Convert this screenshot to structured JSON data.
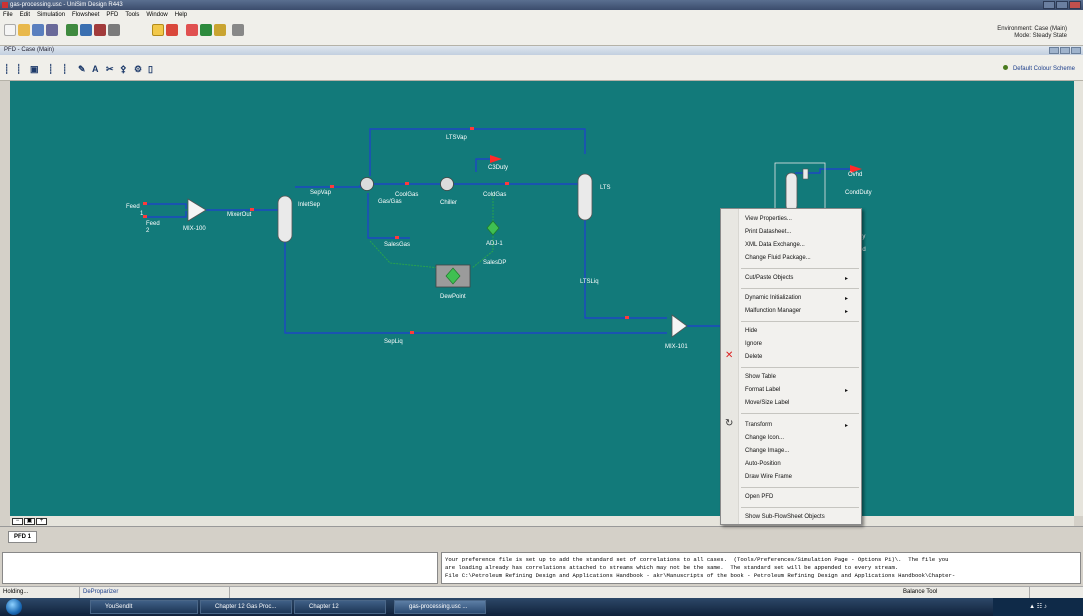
{
  "window": {
    "title": "gas-processing.usc - UniSim Design R443"
  },
  "menubar": {
    "items": [
      "File",
      "Edit",
      "Simulation",
      "Flowsheet",
      "PFD",
      "Tools",
      "Window",
      "Help"
    ]
  },
  "environment": {
    "line1": "Environment: Case (Main)",
    "line2": "Mode: Steady State"
  },
  "pfd": {
    "title": "PFD - Case (Main)",
    "color_scheme": "Default Colour Scheme",
    "tab": "PFD 1",
    "canvas_color": "#127a7a",
    "labels": {
      "feed1": "Feed\n1",
      "feed2": "Feed\n2",
      "mix100": "MIX-100",
      "mixerout": "MixerOut",
      "inletsep": "InletSep",
      "sepvap": "SepVap",
      "gasgas": "Gas/Gas",
      "coolgas": "CoolGas",
      "chiller": "Chiller",
      "coldgas": "ColdGas",
      "c3duty": "C3Duty",
      "lts": "LTS",
      "ltsvap": "LTSVap",
      "salesgas": "SalesGas",
      "adj1": "ADJ-1",
      "salesdp": "SalesDP",
      "dewpoint": "DewPoint",
      "ltsliq": "LTSLiq",
      "sepliq": "SepLiq",
      "mix101": "MIX-101",
      "ovhd": "Ovhd",
      "condduty": "CondDuty",
      "duty": "Duty",
      "prod": "Prod"
    }
  },
  "context_menu": {
    "items": [
      {
        "label": "View Properties...",
        "submenu": false,
        "group": 1
      },
      {
        "label": "Print Datasheet...",
        "submenu": false,
        "group": 1
      },
      {
        "label": "XML Data Exchange...",
        "submenu": false,
        "group": 1
      },
      {
        "label": "Change Fluid Package...",
        "submenu": false,
        "group": 1
      },
      {
        "label": "Cut/Paste Objects",
        "submenu": true,
        "group": 2
      },
      {
        "label": "Dynamic Initialization",
        "submenu": true,
        "group": 3
      },
      {
        "label": "Malfunction Manager",
        "submenu": true,
        "group": 3
      },
      {
        "label": "Hide",
        "submenu": false,
        "group": 4
      },
      {
        "label": "Ignore",
        "submenu": false,
        "group": 4
      },
      {
        "label": "Delete",
        "submenu": false,
        "group": 4,
        "icon": "delete-icon"
      },
      {
        "label": "Show Table",
        "submenu": false,
        "group": 5
      },
      {
        "label": "Format Label",
        "submenu": true,
        "group": 5
      },
      {
        "label": "Move/Size Label",
        "submenu": false,
        "group": 5
      },
      {
        "label": "Transform",
        "submenu": true,
        "group": 6,
        "icon": "transform-icon"
      },
      {
        "label": "Change Icon...",
        "submenu": false,
        "group": 6
      },
      {
        "label": "Change Image...",
        "submenu": false,
        "group": 6
      },
      {
        "label": "Auto-Position",
        "submenu": false,
        "group": 6
      },
      {
        "label": "Draw Wire Frame",
        "submenu": false,
        "group": 6
      },
      {
        "label": "Open PFD",
        "submenu": false,
        "group": 7
      },
      {
        "label": "Show Sub-FlowSheet Objects",
        "submenu": false,
        "group": 8
      }
    ]
  },
  "messages": {
    "line1": "Your preference file is set up to add the standard set of correlations to all cases.  (Tools/Preferences/Simulation Page - Options Pi)\\.  The file you",
    "line2": "are loading already has correlations attached to streams which may not be the same.  The standard set will be appended to every stream.",
    "line3": "File C:\\Petroleum Refining Design and Applications Handbook - akr\\Manuscripts of the book - Petroleum Refining Design and Applications Handbook\\Chapter-"
  },
  "status": {
    "state": "Holding...",
    "package": "DeProparizer",
    "tool": "Balance Tool"
  },
  "taskbar": {
    "items": [
      "YouSendIt",
      "Chapter 12 Gas Proc...",
      "Chapter 12",
      "gas-processing.usc ..."
    ]
  }
}
